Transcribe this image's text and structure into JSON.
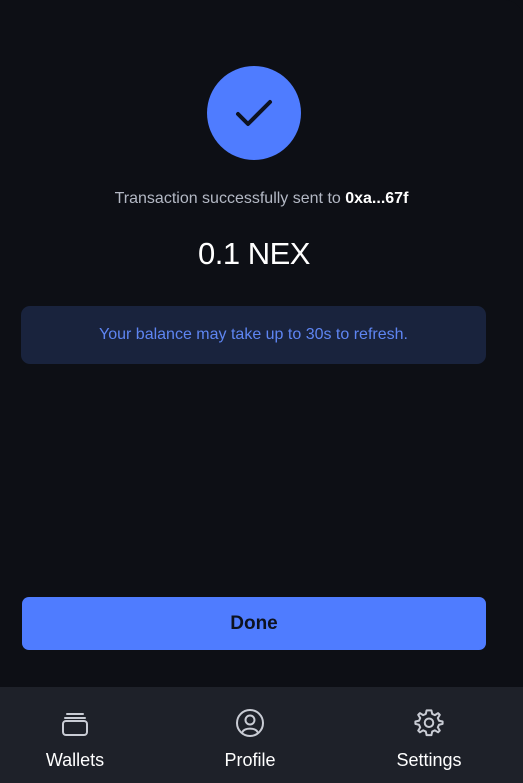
{
  "status": {
    "icon": "checkmark-icon",
    "message_prefix": "Transaction successfully sent to",
    "recipient_short": "0xa...67f"
  },
  "amount": {
    "value": "0.1 NEX"
  },
  "notice": {
    "text": "Your balance may take up to 30s to refresh."
  },
  "actions": {
    "done_label": "Done"
  },
  "nav": {
    "items": [
      {
        "label": "Wallets",
        "icon": "wallets-icon"
      },
      {
        "label": "Profile",
        "icon": "profile-icon"
      },
      {
        "label": "Settings",
        "icon": "gear-icon"
      }
    ]
  },
  "colors": {
    "background": "#0d0f15",
    "accent": "#4f7cff",
    "notice_bg": "#19233d",
    "notice_text": "#5e85f2",
    "nav_bg": "#1e2129"
  }
}
